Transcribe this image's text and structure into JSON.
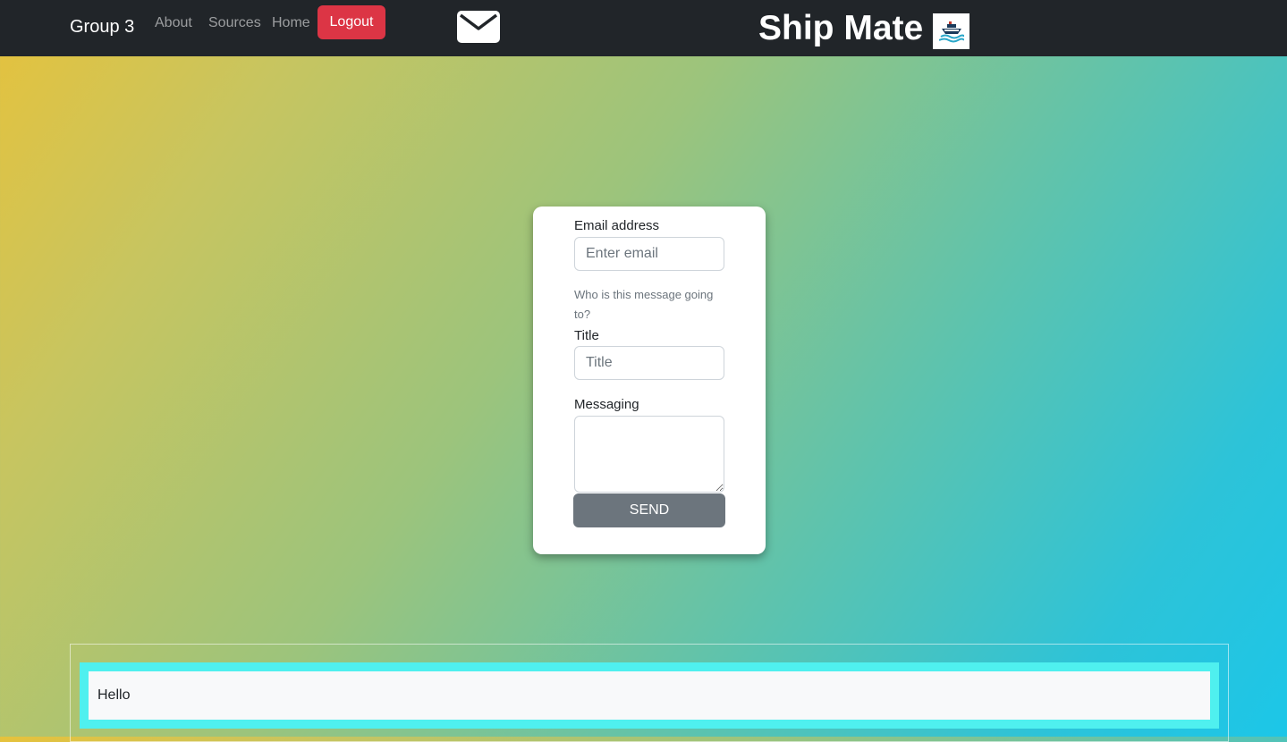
{
  "navbar": {
    "brand": "Group 3",
    "links": [
      "About",
      "Sources",
      "Home"
    ],
    "logout_label": "Logout",
    "site_title": "Ship Mate"
  },
  "form": {
    "email_label": "Email address",
    "email_placeholder": "Enter email",
    "email_help": "Who is this message going to?",
    "title_label": "Title",
    "title_placeholder": "Title",
    "message_label": "Messaging",
    "send_label": "SEND"
  },
  "messages": [
    {
      "text": "Hello"
    }
  ],
  "colors": {
    "navbar_bg": "#212529",
    "logout_bg": "#dc3545",
    "send_bg": "#6c757d",
    "message_border": "#4ff0ef",
    "gradient_start": "#e6c23c",
    "gradient_end": "#1cc6e8"
  },
  "icons": {
    "mail": "envelope-icon",
    "logo": "ship-logo-icon"
  }
}
